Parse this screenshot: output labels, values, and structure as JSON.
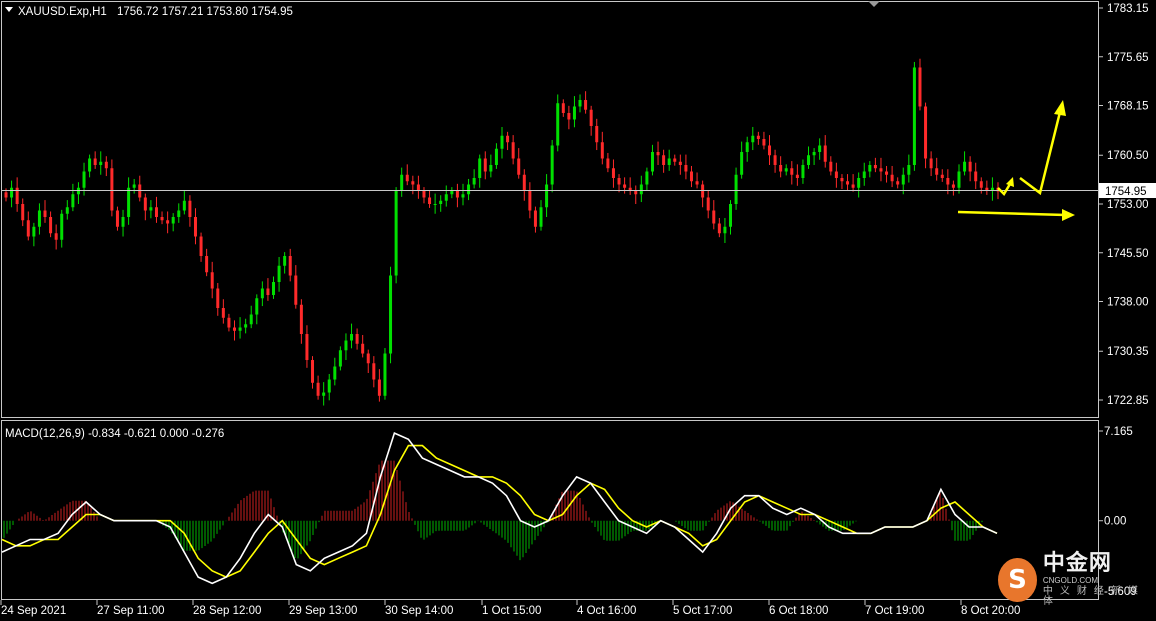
{
  "header": {
    "symbol": "XAUUSD.Exp,H1",
    "ohlc": "1756.72 1757.21 1753.80 1754.95"
  },
  "price_axis": {
    "ticks": [
      "1783.15",
      "1775.65",
      "1768.15",
      "1760.50",
      "1753.00",
      "1745.50",
      "1738.00",
      "1730.35",
      "1722.85"
    ],
    "current_price": "1754.95"
  },
  "macd": {
    "label": "MACD(12,26,9) -0.834 -0.621 0.000 -0.276",
    "ticks": [
      "7.165",
      "0.00",
      "-5.609"
    ]
  },
  "time_axis": {
    "labels": [
      "24 Sep 2021",
      "27 Sep 11:00",
      "28 Sep 12:00",
      "29 Sep 13:00",
      "30 Sep 14:00",
      "1 Oct 15:00",
      "4 Oct 16:00",
      "5 Oct 17:00",
      "6 Oct 18:00",
      "7 Oct 19:00",
      "8 Oct 20:00"
    ]
  },
  "watermark": {
    "main": "中金网",
    "sub": "CNGOLD.COM",
    "tagline": "中义财经新媒体",
    "glyph": "S"
  },
  "colors": {
    "bull": "#00e000",
    "bear": "#ff2a2a",
    "macd_line": "#ffffff",
    "signal_line": "#ffff00",
    "arrows": "#ffff00",
    "grid": "#c8c8c8"
  },
  "chart_data": [
    {
      "type": "candlestick",
      "title": "XAUUSD.Exp,H1",
      "ylim": [
        1720.5,
        1784.5
      ],
      "current_price": 1754.95,
      "series": [
        {
          "values": [
            1754.0,
            1755.5,
            1753.0,
            1750.5,
            1748.0,
            1749.5,
            1752.0,
            1751.0,
            1748.5,
            1747.5,
            1751.5,
            1752.5,
            1754.5,
            1755.5,
            1758.0,
            1760.0,
            1759.0,
            1759.5,
            1758.5,
            1752.0,
            1749.5,
            1751.0,
            1755.5,
            1756.0,
            1754.0,
            1752.0,
            1752.5,
            1751.0,
            1750.5,
            1750.0,
            1751.0,
            1752.0,
            1753.5,
            1751.0,
            1748.0,
            1745.0,
            1742.5,
            1740.0,
            1737.0,
            1735.5,
            1734.0,
            1733.5,
            1734.0,
            1734.5,
            1736.0,
            1738.5,
            1740.0,
            1739.0,
            1741.0,
            1743.5,
            1745.0,
            1742.0,
            1737.5,
            1733.0,
            1729.0,
            1725.5,
            1723.5,
            1724.0,
            1726.0,
            1728.0,
            1730.5,
            1732.0,
            1733.0,
            1731.5,
            1730.0,
            1728.5,
            1726.0,
            1723.5,
            1730.0,
            1742.0,
            1755.0,
            1757.5,
            1756.5,
            1756.0,
            1755.0,
            1754.0,
            1753.0,
            1753.0,
            1753.5,
            1754.5,
            1755.0,
            1754.0,
            1754.5,
            1756.0,
            1757.0,
            1760.0,
            1758.0,
            1759.0,
            1761.5,
            1763.5,
            1762.5,
            1760.0,
            1757.5,
            1755.0,
            1752.0,
            1749.5,
            1752.5,
            1756.0,
            1762.0,
            1768.5,
            1767.0,
            1766.0,
            1768.0,
            1769.0,
            1767.5,
            1765.0,
            1762.5,
            1760.0,
            1758.5,
            1757.0,
            1756.0,
            1755.5,
            1755.0,
            1754.5,
            1756.0,
            1758.0,
            1761.0,
            1760.5,
            1759.0,
            1760.0,
            1759.5,
            1759.0,
            1758.0,
            1756.5,
            1756.0,
            1754.0,
            1752.0,
            1750.0,
            1748.5,
            1749.5,
            1753.0,
            1757.5,
            1761.0,
            1762.5,
            1763.5,
            1763.0,
            1762.0,
            1760.5,
            1759.0,
            1758.0,
            1758.5,
            1757.5,
            1757.0,
            1759.0,
            1760.5,
            1761.0,
            1762.0,
            1759.5,
            1758.0,
            1757.0,
            1756.5,
            1756.0,
            1755.5,
            1757.0,
            1758.0,
            1759.0,
            1758.5,
            1758.0,
            1757.5,
            1756.5,
            1756.0,
            1757.5,
            1759.0,
            1774.0,
            1768.0,
            1760.0,
            1758.5,
            1757.5,
            1757.0,
            1756.0,
            1755.5,
            1758.0,
            1759.5,
            1758.0,
            1756.5,
            1755.5,
            1755.0,
            1755.5,
            1754.95
          ]
        }
      ]
    },
    {
      "type": "line",
      "title": "MACD(12,26,9)",
      "ylim": [
        -5.609,
        7.165
      ],
      "series": [
        {
          "name": "MACD",
          "values": [
            -2.5,
            -2.0,
            -1.5,
            -1.5,
            -1.0,
            0.5,
            1.5,
            0.5,
            0.0,
            0.0,
            0.0,
            0.0,
            -0.5,
            -2.5,
            -4.5,
            -5.0,
            -4.5,
            -3.0,
            -1.0,
            0.5,
            -0.5,
            -3.5,
            -4.0,
            -3.0,
            -2.5,
            -2.0,
            -1.0,
            3.5,
            7.0,
            6.5,
            5.0,
            4.5,
            4.0,
            3.5,
            3.5,
            3.0,
            2.0,
            0.0,
            -0.5,
            0.0,
            2.0,
            3.5,
            3.0,
            1.5,
            0.0,
            -0.5,
            -1.0,
            0.0,
            -0.5,
            -1.5,
            -2.5,
            -1.0,
            1.0,
            2.0,
            2.0,
            1.0,
            0.5,
            1.0,
            0.5,
            -0.5,
            -1.0,
            -1.0,
            -1.0,
            -0.5,
            -0.5,
            -0.5,
            0.0,
            2.5,
            0.5,
            -0.5,
            -0.5,
            -1.0
          ]
        },
        {
          "name": "Signal",
          "values": [
            -1.5,
            -2.0,
            -2.0,
            -1.5,
            -1.5,
            -0.5,
            0.5,
            0.5,
            0.0,
            0.0,
            0.0,
            0.0,
            0.0,
            -1.0,
            -3.0,
            -4.0,
            -4.5,
            -4.0,
            -2.5,
            -1.0,
            0.0,
            -1.5,
            -3.0,
            -3.5,
            -3.0,
            -2.5,
            -2.0,
            0.5,
            4.0,
            6.0,
            6.0,
            5.0,
            4.5,
            4.0,
            3.5,
            3.5,
            3.0,
            2.0,
            0.5,
            0.0,
            0.5,
            2.0,
            3.0,
            2.5,
            1.0,
            0.0,
            -0.5,
            0.0,
            -0.5,
            -1.0,
            -2.0,
            -1.5,
            0.0,
            1.5,
            2.0,
            1.5,
            1.0,
            0.5,
            0.5,
            0.0,
            -0.5,
            -1.0,
            -1.0,
            -0.5,
            -0.5,
            -0.5,
            0.0,
            1.0,
            1.5,
            0.5,
            -0.5,
            -1.0
          ]
        }
      ]
    }
  ]
}
